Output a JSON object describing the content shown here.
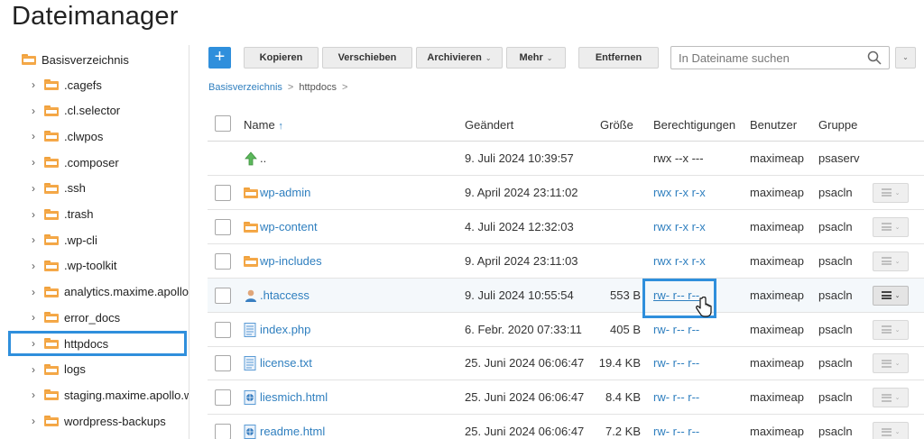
{
  "page_title": "Dateimanager",
  "sidebar": {
    "root": "Basisverzeichnis",
    "items": [
      {
        "label": ".cagefs"
      },
      {
        "label": ".cl.selector"
      },
      {
        "label": ".clwpos"
      },
      {
        "label": ".composer"
      },
      {
        "label": ".ssh"
      },
      {
        "label": ".trash"
      },
      {
        "label": ".wp-cli"
      },
      {
        "label": ".wp-toolkit"
      },
      {
        "label": "analytics.maxime.apollo.w"
      },
      {
        "label": "error_docs"
      },
      {
        "label": "httpdocs",
        "selected": true
      },
      {
        "label": "logs"
      },
      {
        "label": "staging.maxime.apollo.w"
      },
      {
        "label": "wordpress-backups"
      }
    ]
  },
  "toolbar": {
    "add_label": "+",
    "copy": "Kopieren",
    "move": "Verschieben",
    "archive": "Archivieren",
    "more": "Mehr",
    "remove": "Entfernen",
    "search_placeholder": "In Dateiname suchen"
  },
  "breadcrumb": {
    "root": "Basisverzeichnis",
    "current": "httpdocs",
    "separator": ">"
  },
  "table": {
    "headers": {
      "name": "Name",
      "sort_indicator": "↑",
      "modified": "Geändert",
      "size": "Größe",
      "permissions": "Berechtigungen",
      "user": "Benutzer",
      "group": "Gruppe"
    },
    "rows": [
      {
        "name": "..",
        "type": "up",
        "modified": "9. Juli 2024 10:39:57",
        "size": "",
        "permissions": "rwx --x ---",
        "user": "maximeap",
        "group": "psaserv"
      },
      {
        "name": "wp-admin",
        "type": "folder",
        "modified": "9. April 2024 23:11:02",
        "size": "",
        "permissions": "rwx r-x r-x",
        "user": "maximeap",
        "group": "psacln"
      },
      {
        "name": "wp-content",
        "type": "folder",
        "modified": "4. Juli 2024 12:32:03",
        "size": "",
        "permissions": "rwx r-x r-x",
        "user": "maximeap",
        "group": "psacln"
      },
      {
        "name": "wp-includes",
        "type": "folder",
        "modified": "9. April 2024 23:11:03",
        "size": "",
        "permissions": "rwx r-x r-x",
        "user": "maximeap",
        "group": "psacln"
      },
      {
        "name": ".htaccess",
        "type": "user",
        "modified": "9. Juli 2024 10:55:54",
        "size": "553 B",
        "permissions": "rw- r-- r--",
        "user": "maximeap",
        "group": "psacln",
        "highlighted": true
      },
      {
        "name": "index.php",
        "type": "file",
        "modified": "6. Febr. 2020 07:33:11",
        "size": "405 B",
        "permissions": "rw- r-- r--",
        "user": "maximeap",
        "group": "psacln"
      },
      {
        "name": "license.txt",
        "type": "file",
        "modified": "25. Juni 2024 06:06:47",
        "size": "19.4 KB",
        "permissions": "rw- r-- r--",
        "user": "maximeap",
        "group": "psacln"
      },
      {
        "name": "liesmich.html",
        "type": "html",
        "modified": "25. Juni 2024 06:06:47",
        "size": "8.4 KB",
        "permissions": "rw- r-- r--",
        "user": "maximeap",
        "group": "psacln"
      },
      {
        "name": "readme.html",
        "type": "html",
        "modified": "25. Juni 2024 06:06:47",
        "size": "7.2 KB",
        "permissions": "rw- r-- r--",
        "user": "maximeap",
        "group": "psacln"
      }
    ]
  },
  "colors": {
    "accent": "#2f8fdc",
    "link": "#2f7fbf",
    "folder": "#f5a94a",
    "selection_outline": "#2f8fdc"
  },
  "icons": {
    "up": "green-up-arrow-icon",
    "folder": "folder-icon",
    "user": "user-file-icon",
    "file": "document-icon",
    "html": "html-file-icon",
    "search": "search-icon",
    "actions": "hamburger-menu-icon"
  }
}
